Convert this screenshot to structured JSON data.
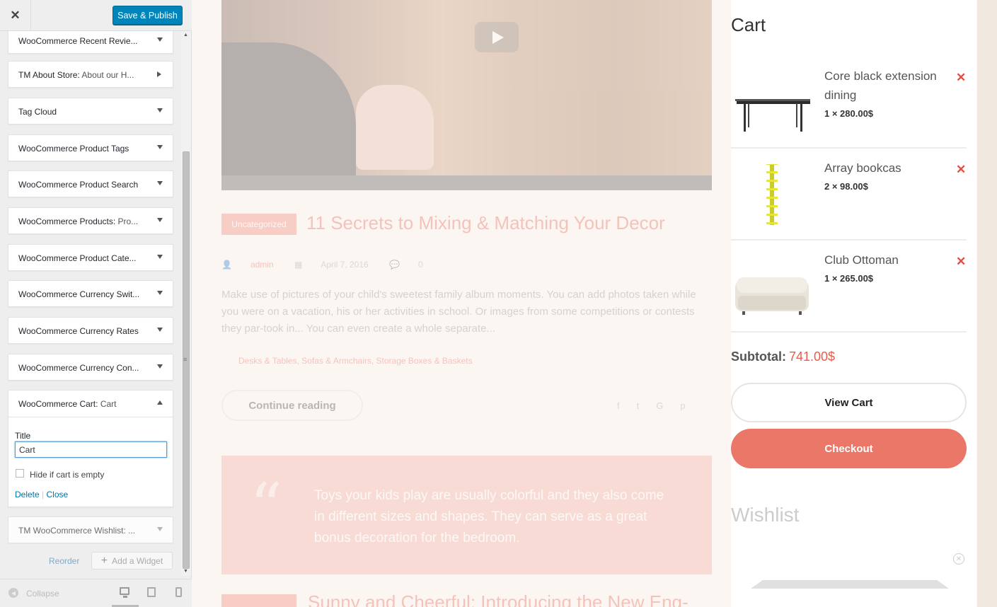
{
  "customizer": {
    "close_icon": "close-icon",
    "save_publish_label": "Save & Publish",
    "widgets": [
      {
        "name": "WooCommerce Recent Revie...",
        "sub": ""
      },
      {
        "name": "TM About Store:",
        "sub": " About our H..."
      },
      {
        "name": "Tag Cloud",
        "sub": ""
      },
      {
        "name": "WooCommerce Product Tags",
        "sub": ""
      },
      {
        "name": "WooCommerce Product Search",
        "sub": ""
      },
      {
        "name": "WooCommerce Products:",
        "sub": " Pro..."
      },
      {
        "name": "WooCommerce Product Cate...",
        "sub": ""
      },
      {
        "name": "WooCommerce Currency Swit...",
        "sub": ""
      },
      {
        "name": "WooCommerce Currency Rates",
        "sub": ""
      },
      {
        "name": "WooCommerce Currency Con...",
        "sub": ""
      }
    ],
    "cart_widget": {
      "name": "WooCommerce Cart:",
      "sub": " Cart",
      "title_label": "Title",
      "title_value": "Cart",
      "hide_label": "Hide if cart is empty",
      "delete_label": "Delete",
      "separator": " | ",
      "close_label": "Close"
    },
    "wishlist_widget": {
      "name": "TM WooCommerce Wishlist: ..."
    },
    "reorder_label": "Reorder",
    "add_widget_label": "Add a Widget",
    "collapse_label": "Collapse"
  },
  "preview": {
    "post": {
      "category": "Uncategorized",
      "title": "11 Secrets to Mixing & Matching Your Decor",
      "author": "admin",
      "date": "April 7, 2016",
      "comments": "0",
      "excerpt": "Make use of pictures of your child's sweetest family album moments. You can add photos taken while you were on a vacation, his or her activities in school. Or images from some competitions or contests they par-took in... You can even create a whole separate...",
      "tags": "Desks & Tables, Sofas & Armchairs, Storage Boxes & Baskets",
      "continue_label": "Continue reading",
      "share_icons": [
        "facebook-icon",
        "twitter-icon",
        "google-plus-icon",
        "pinterest-icon"
      ]
    },
    "quote": "Toys your kids play are usually colorful and they also come in different sizes and shapes. They can serve as a great bonus decoration for the bedroom.",
    "next_post_title": "Sunny and Cheerful: Introducing the New Eng-"
  },
  "cart": {
    "title": "Cart",
    "items": [
      {
        "name": "Core black extension dining",
        "qty": "1 × 280.00$"
      },
      {
        "name": "Array bookcas",
        "qty": "2 × 98.00$"
      },
      {
        "name": "Club Ottoman",
        "qty": "1 × 265.00$"
      }
    ],
    "subtotal_label": "Subtotal:",
    "subtotal_value": "741.00$",
    "view_cart_label": "View Cart",
    "checkout_label": "Checkout",
    "wishlist_title": "Wishlist"
  },
  "colors": {
    "accent": "#e95c4c",
    "publish": "#0085ba",
    "checkout": "#ea7767"
  }
}
